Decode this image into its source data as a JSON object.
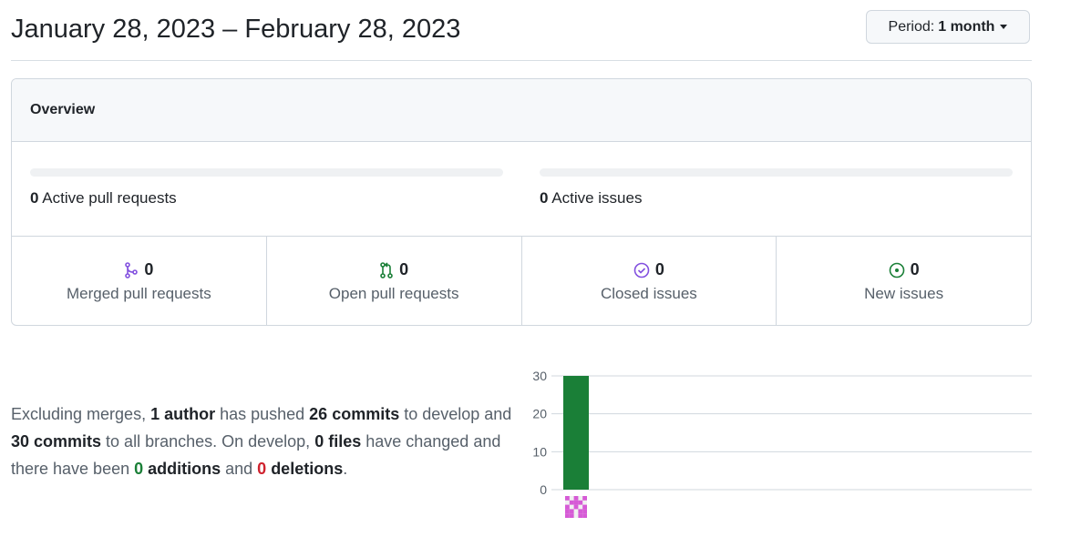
{
  "header": {
    "title": "January 28, 2023 – February 28, 2023",
    "period_label": "Period:",
    "period_value": "1 month"
  },
  "overview": {
    "title": "Overview",
    "active_prs": {
      "count": "0",
      "label": "Active pull requests"
    },
    "active_issues": {
      "count": "0",
      "label": "Active issues"
    },
    "cells": [
      {
        "count": "0",
        "label": "Merged pull requests",
        "icon": "git-merge-icon",
        "color": "#8250df"
      },
      {
        "count": "0",
        "label": "Open pull requests",
        "icon": "git-pull-request-icon",
        "color": "#1a7f37"
      },
      {
        "count": "0",
        "label": "Closed issues",
        "icon": "issue-closed-icon",
        "color": "#8250df"
      },
      {
        "count": "0",
        "label": "New issues",
        "icon": "issue-opened-icon",
        "color": "#1a7f37"
      }
    ]
  },
  "summary": {
    "t1": "Excluding merges, ",
    "authors": "1 author",
    "t2": " has pushed ",
    "commits_branch": "26 commits",
    "t3": " to develop and ",
    "commits_all": "30 commits",
    "t4": " to all branches. On develop, ",
    "files": "0 files",
    "t5": " have changed and there have been ",
    "additions_n": "0",
    "additions": " additions",
    "t6": " and ",
    "deletions_n": "0",
    "deletions": " deletions",
    "t7": "."
  },
  "chart_data": {
    "type": "bar",
    "categories": [
      "author-1"
    ],
    "values": [
      30
    ],
    "yticks": [
      "0",
      "10",
      "20",
      "30"
    ],
    "ylim": [
      0,
      30
    ],
    "bar_color": "#1a7f37",
    "grid": true
  }
}
